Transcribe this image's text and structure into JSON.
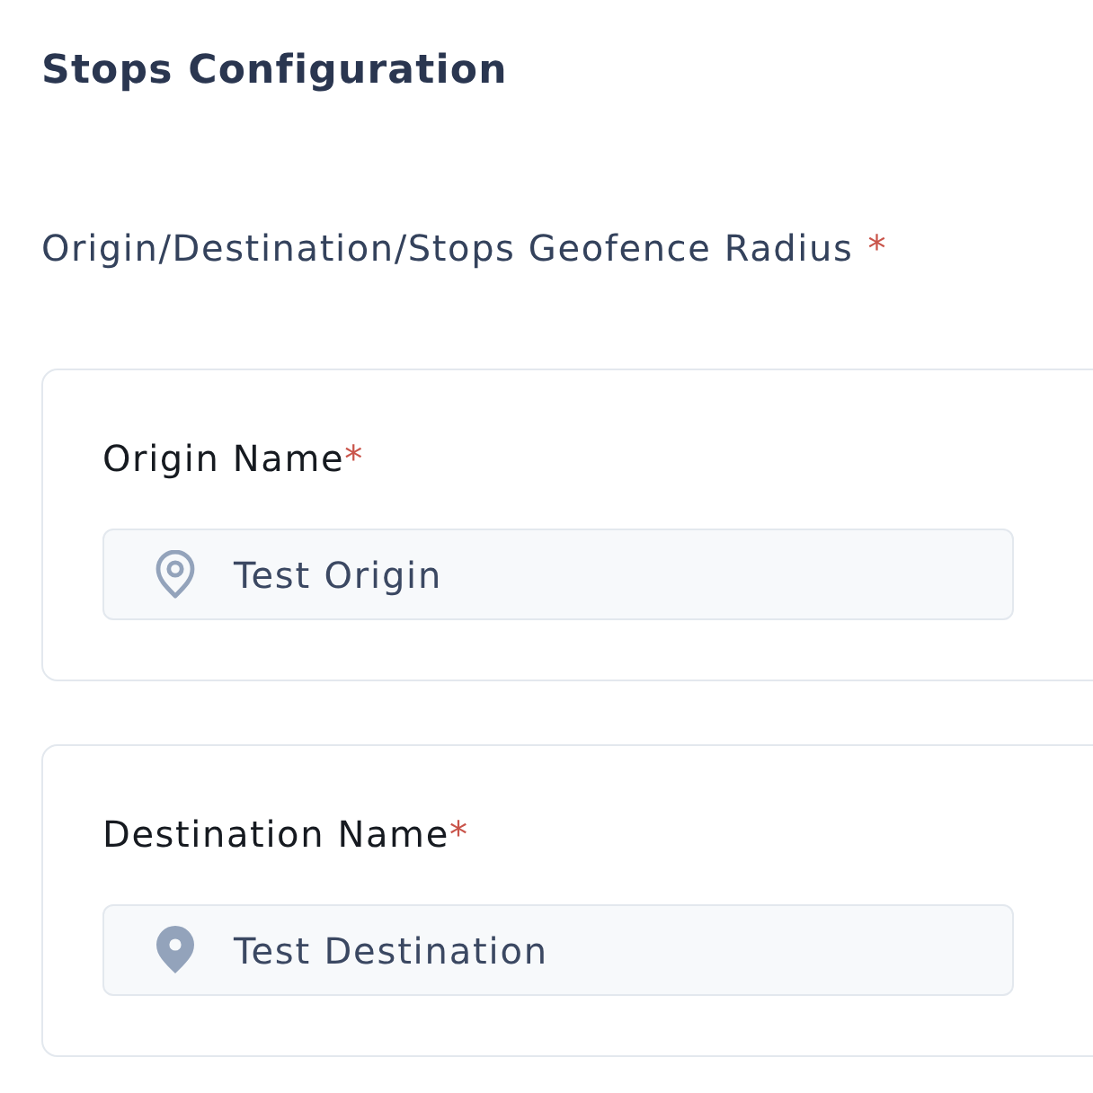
{
  "section": {
    "title": "Stops Configuration"
  },
  "radius_field": {
    "label": "Origin/Destination/Stops Geofence Radius",
    "required_mark": "*"
  },
  "stops": [
    {
      "kind": "origin",
      "label": "Origin Name",
      "required_mark": "*",
      "value": "Test Origin"
    },
    {
      "kind": "destination",
      "label": "Destination Name",
      "required_mark": "*",
      "value": "Test Destination"
    }
  ]
}
